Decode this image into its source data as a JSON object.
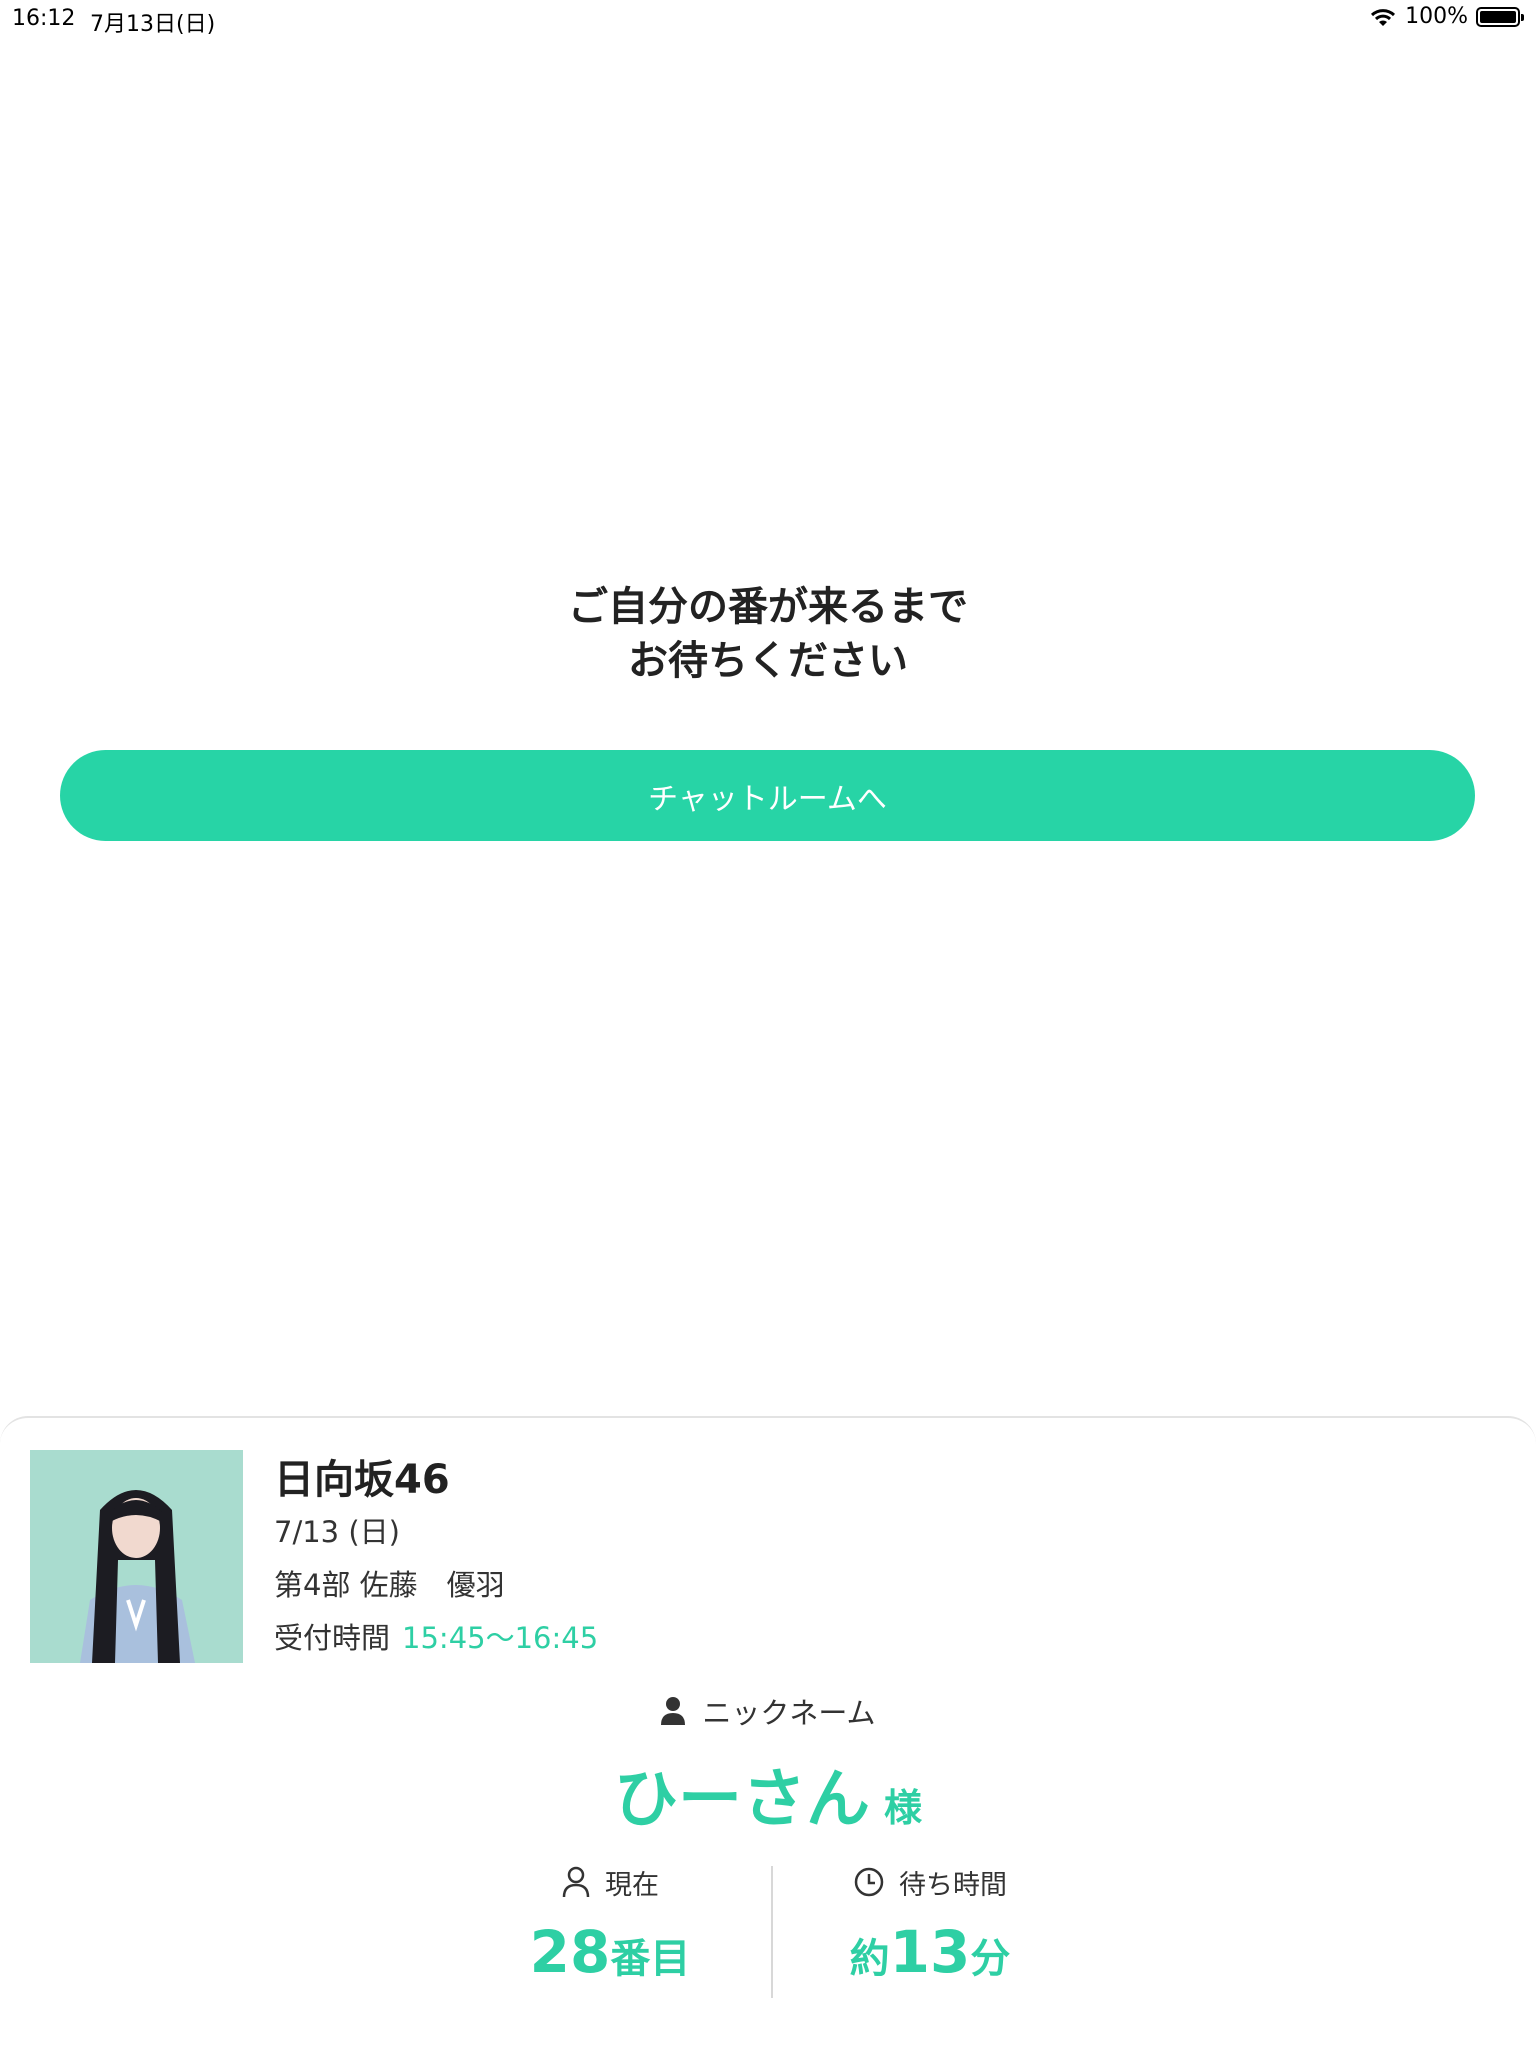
{
  "status_bar": {
    "time": "16:12",
    "date": "7月13日(日)",
    "battery": "100%",
    "wifi_icon": "wifi-icon",
    "battery_icon": "battery-icon"
  },
  "main": {
    "message_line1": "ご自分の番が来るまで",
    "message_line2": "お待ちください",
    "chat_button_label": "チャットルームへ",
    "accent_color": "#27d4a6"
  },
  "card": {
    "group_name": "日向坂46",
    "date": "7/13 (日)",
    "session": "第4部  佐藤　優羽",
    "reception_label": "受付時間",
    "reception_time": "15:45〜16:45",
    "nickname_label": "ニックネーム",
    "nickname": "ひーさん",
    "nickname_suffix": "様",
    "current_label": "現在",
    "current_number": "28",
    "current_unit": "番目",
    "wait_label": "待ち時間",
    "wait_prefix": "約",
    "wait_number": "13",
    "wait_unit": "分"
  }
}
